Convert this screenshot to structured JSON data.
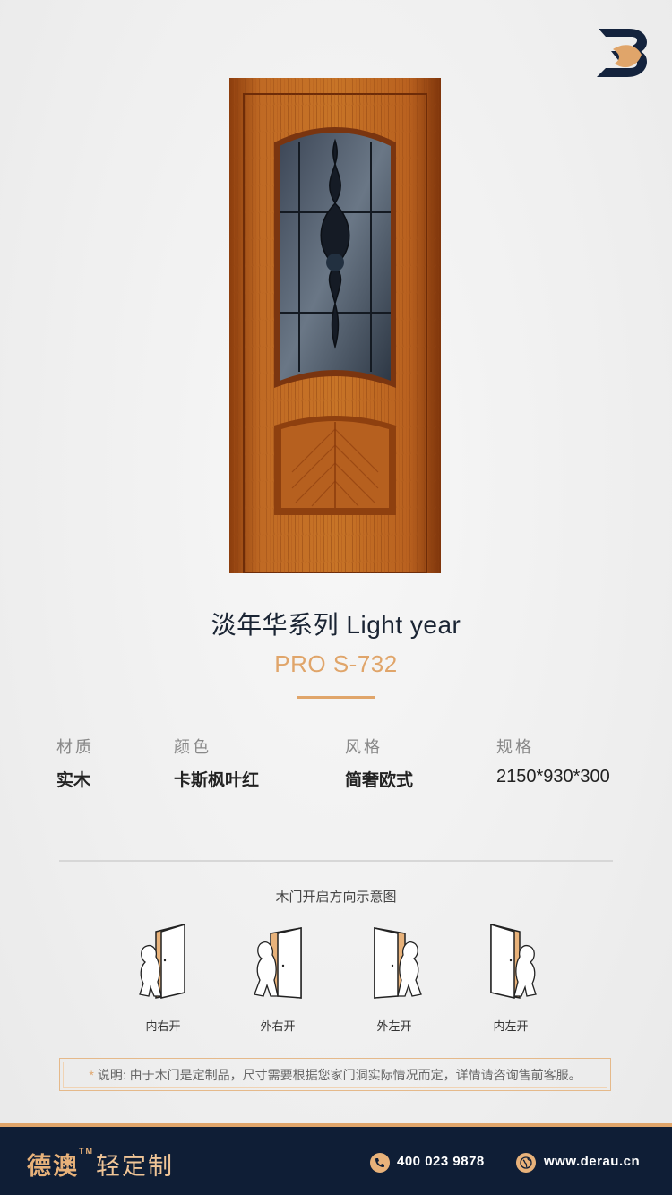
{
  "brand": {
    "logo_icon": "brand-logo-icon",
    "accent_color": "#e0a56a",
    "navy_color": "#0f1e36"
  },
  "product": {
    "series_title": "淡年华系列  Light year",
    "model_code": "PRO S-732",
    "image_icon": "door-product-image"
  },
  "specs": [
    {
      "label": "材质",
      "value": "实木"
    },
    {
      "label": "颜色",
      "value": "卡斯枫叶红"
    },
    {
      "label": "风格",
      "value": "简奢欧式"
    },
    {
      "label": "规格",
      "value": "2150*930*300"
    }
  ],
  "diagram": {
    "title": "木门开启方向示意图",
    "items": [
      {
        "label": "内右开",
        "icon": "door-open-inner-right-icon"
      },
      {
        "label": "外右开",
        "icon": "door-open-outer-right-icon"
      },
      {
        "label": "外左开",
        "icon": "door-open-outer-left-icon"
      },
      {
        "label": "内左开",
        "icon": "door-open-inner-left-icon"
      }
    ]
  },
  "note": {
    "star": "*",
    "text": "说明: 由于木门是定制品，尺寸需要根据您家门洞实际情况而定，详情请咨询售前客服。"
  },
  "footer": {
    "brand_name": "德澳",
    "brand_tm": "TM",
    "brand_suffix": "轻定制",
    "phone_icon": "phone-icon",
    "phone": "400 023 9878",
    "web_icon": "globe-icon",
    "website": "www.derau.cn"
  }
}
